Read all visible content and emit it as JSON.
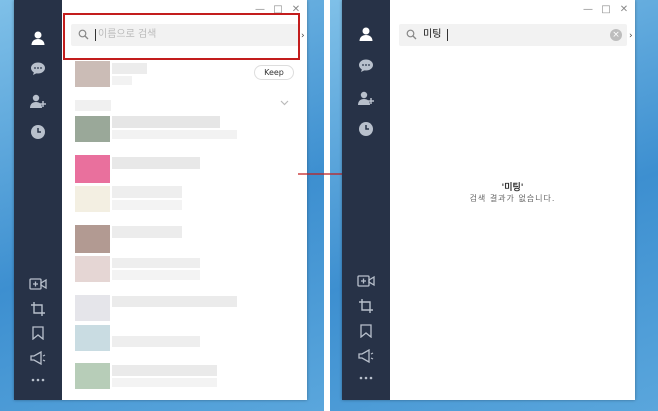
{
  "window_controls": [
    "—",
    "□",
    "✕"
  ],
  "before": {
    "search": {
      "placeholder": "이름으로 검색",
      "value": ""
    },
    "keep_button": "Keep"
  },
  "after": {
    "search": {
      "value": "미팅"
    },
    "empty_state": {
      "query": "'미팅'",
      "message": "검색 결과가 없습니다."
    }
  },
  "sidebar_icons_top": [
    "person-icon",
    "chat-bubble-icon",
    "add-friend-icon",
    "clock-icon"
  ],
  "sidebar_icons_bottom": [
    "video-plus-icon",
    "crop-icon",
    "bookmark-icon",
    "megaphone-icon",
    "more-icon"
  ],
  "colors": {
    "sidebar": "#273247",
    "highlight": "#c31d1d",
    "arrow": "#c31d1d"
  }
}
